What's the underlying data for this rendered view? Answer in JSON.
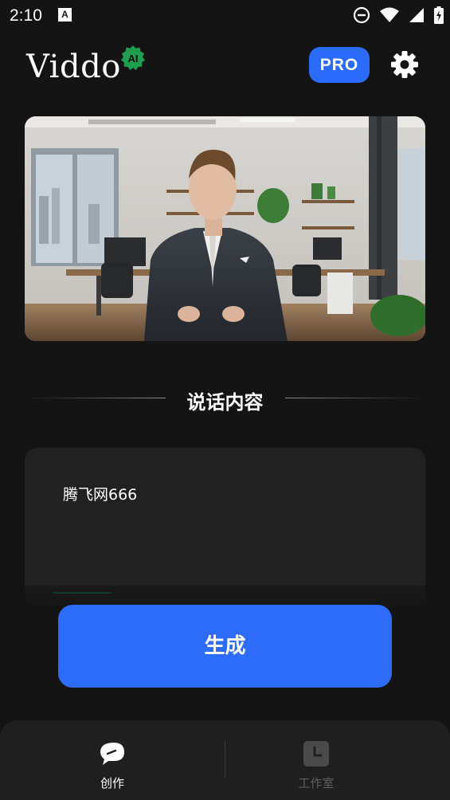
{
  "status_bar": {
    "time": "2:10",
    "notification_letter": "A"
  },
  "header": {
    "logo_text": "Viddo",
    "ai_badge": "AI",
    "pro_label": "PRO"
  },
  "section": {
    "title": "说话内容"
  },
  "speech": {
    "text": "腾飞网666"
  },
  "generate": {
    "label": "生成"
  },
  "bottom_nav": {
    "items": [
      {
        "label": "创作",
        "icon": "create-icon",
        "active": true
      },
      {
        "label": "工作室",
        "icon": "studio-clock-icon",
        "active": false
      }
    ]
  },
  "colors": {
    "accent": "#2b6bfa",
    "background": "#141414",
    "card": "#212121",
    "ai_badge": "#1e9e4f"
  }
}
